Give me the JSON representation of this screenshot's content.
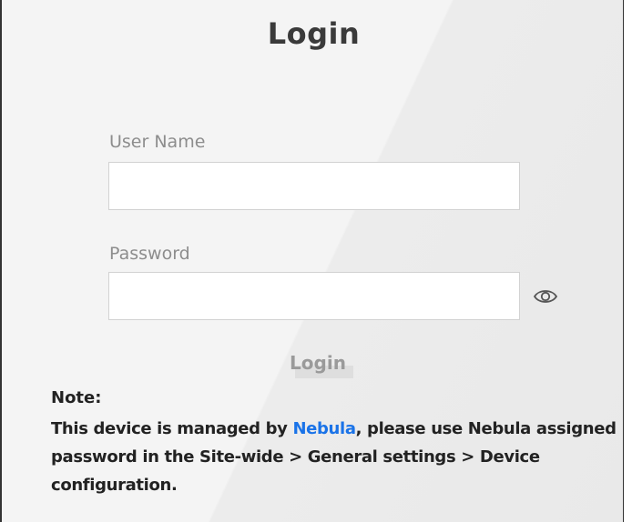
{
  "login": {
    "title": "Login",
    "username_label": "User Name",
    "username_value": "",
    "password_label": "Password",
    "password_value": "",
    "show_password_icon": "eye-icon",
    "button_label": "Login"
  },
  "note": {
    "title": "Note:",
    "prefix": "This device is managed by ",
    "link_text": "Nebula",
    "suffix": ", please use Nebula assigned password in the Site-wide > General settings > Device configuration."
  },
  "colors": {
    "link": "#1a73e8",
    "text": "#222222",
    "muted_label": "#8d8d8d",
    "panel_background": "#f4f4f4"
  }
}
